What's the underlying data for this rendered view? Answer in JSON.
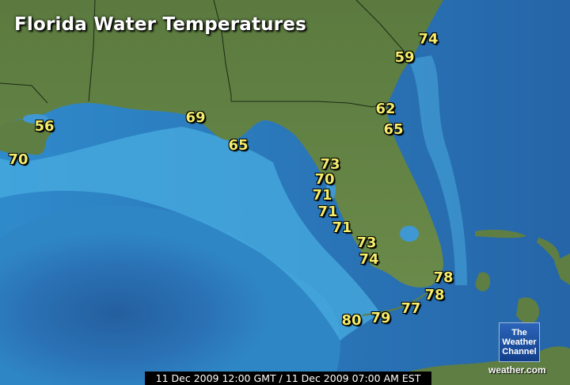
{
  "title": "Florida Water Temperatures",
  "timestamp": "11 Dec 2009 12:00 GMT / 11 Dec 2009 07:00 AM EST",
  "logo": {
    "line1": "The",
    "line2": "Weather",
    "line3": "Channel",
    "url": "weather.com"
  },
  "colors": {
    "label": "#f4ec6a",
    "land": "#5f7e43",
    "deep_water": "#2a72b5",
    "shallow_water": "#46a9dc"
  },
  "temperatures": [
    {
      "id": "jacksonville-north",
      "value": "74"
    },
    {
      "id": "jacksonville",
      "value": "59"
    },
    {
      "id": "daytona",
      "value": "62"
    },
    {
      "id": "cape-canaveral",
      "value": "65"
    },
    {
      "id": "panama-city",
      "value": "69"
    },
    {
      "id": "apalachicola",
      "value": "65"
    },
    {
      "id": "new-orleans",
      "value": "56"
    },
    {
      "id": "louisiana-offshore",
      "value": "70"
    },
    {
      "id": "clearwater",
      "value": "73"
    },
    {
      "id": "st-petersburg",
      "value": "70"
    },
    {
      "id": "sarasota-north",
      "value": "71"
    },
    {
      "id": "sarasota",
      "value": "71"
    },
    {
      "id": "venice",
      "value": "71"
    },
    {
      "id": "fort-myers",
      "value": "73"
    },
    {
      "id": "naples",
      "value": "74"
    },
    {
      "id": "fort-lauderdale",
      "value": "78"
    },
    {
      "id": "miami",
      "value": "78"
    },
    {
      "id": "key-largo",
      "value": "77"
    },
    {
      "id": "marathon",
      "value": "79"
    },
    {
      "id": "key-west",
      "value": "80"
    }
  ]
}
